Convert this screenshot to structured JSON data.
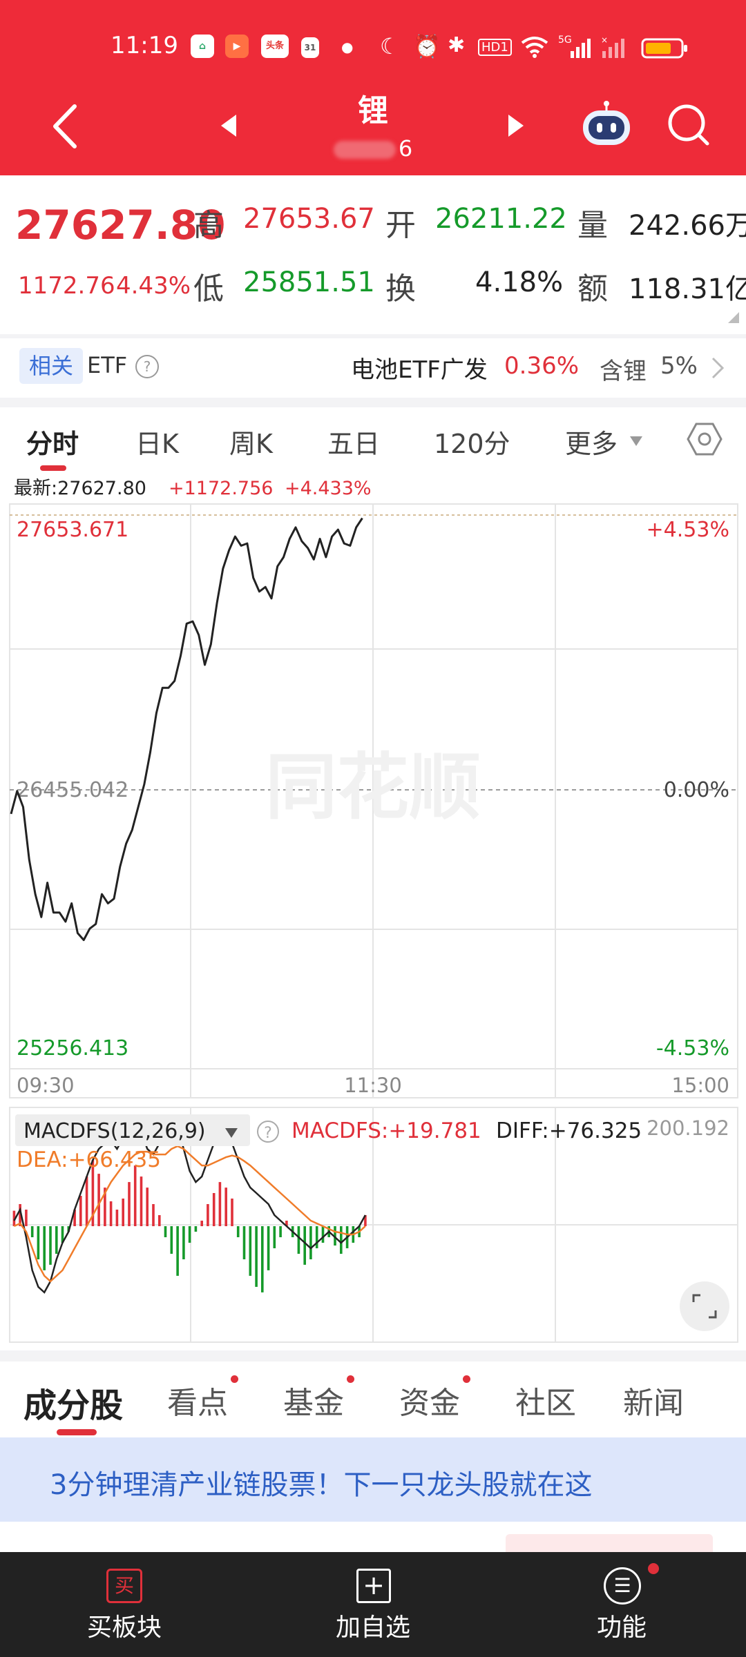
{
  "status_bar": {
    "time": "11:19",
    "icons": [
      "app-notification-icon",
      "video-app-icon",
      "toutiao-icon",
      "calendar-icon",
      "dot-icon",
      "moon-icon",
      "alarm-icon",
      "bluetooth-icon",
      "hd-icon",
      "wifi-icon",
      "signal-5g-icon",
      "signal-icon",
      "battery-icon"
    ],
    "toutiao_label": "头条",
    "hd_label": "HD1",
    "net_label": "5G"
  },
  "header": {
    "title": "锂",
    "code_suffix": "6"
  },
  "quote": {
    "price": "27627.80",
    "change": "1172.76",
    "change_pct": "4.43%",
    "high_label": "高",
    "high": "27653.67",
    "low_label": "低",
    "low": "25851.51",
    "open_label": "开",
    "open": "26211.22",
    "turnover_label": "换",
    "turnover": "4.18%",
    "volume_label": "量",
    "volume": "242.66万",
    "amount_label": "额",
    "amount": "118.31亿"
  },
  "etf": {
    "tag": "相关",
    "label": "ETF",
    "help": "?",
    "name": "电池ETF广发",
    "pct": "0.36%",
    "contain_label": "含锂",
    "contain_pct": "5%",
    "colors": {
      "tag_bg": "#e7eefc",
      "tag_text": "#3b6fd6"
    }
  },
  "period_tabs": {
    "items": [
      {
        "label": "分时",
        "active": true
      },
      {
        "label": "日K",
        "active": false
      },
      {
        "label": "周K",
        "active": false
      },
      {
        "label": "五日",
        "active": false
      },
      {
        "label": "120分",
        "active": false
      },
      {
        "label": "更多",
        "active": false
      }
    ]
  },
  "chart_header": {
    "latest_label": "最新:27627.80",
    "change": "+1172.756",
    "change_pct": "+4.433%"
  },
  "watermark": "同花顺",
  "chart_data": [
    {
      "type": "line",
      "name": "intraday",
      "y_top": "27653.671",
      "y_mid": "26455.042",
      "y_bottom": "25256.413",
      "pct_top": "+4.53%",
      "pct_mid": "0.00%",
      "pct_bottom": "-4.53%",
      "x_labels": [
        "09:30",
        "11:30",
        "15:00"
      ],
      "xlim": [
        0,
        240
      ],
      "ylim": [
        25256.413,
        27653.671
      ],
      "baseline": 26455.042,
      "x": [
        0,
        2,
        4,
        6,
        8,
        10,
        12,
        14,
        16,
        18,
        20,
        22,
        24,
        26,
        28,
        30,
        32,
        34,
        36,
        38,
        40,
        42,
        44,
        46,
        48,
        50,
        52,
        54,
        56,
        58,
        60,
        62,
        64,
        66,
        68,
        70,
        72,
        74,
        76,
        78,
        80,
        82,
        84,
        86,
        88,
        90,
        92,
        94,
        96,
        98,
        100,
        102,
        104,
        106,
        108,
        110,
        112,
        114,
        116
      ],
      "y": [
        26350,
        26450,
        26380,
        26150,
        26000,
        25900,
        26050,
        25920,
        25920,
        25880,
        25960,
        25830,
        25800,
        25850,
        25870,
        26000,
        25960,
        25980,
        26120,
        26220,
        26280,
        26380,
        26480,
        26620,
        26790,
        26900,
        26900,
        26930,
        27040,
        27180,
        27190,
        27130,
        27000,
        27090,
        27270,
        27420,
        27500,
        27560,
        27520,
        27530,
        27380,
        27320,
        27340,
        27290,
        27430,
        27470,
        27550,
        27600,
        27540,
        27510,
        27460,
        27550,
        27470,
        27560,
        27590,
        27530,
        27520,
        27600,
        27640
      ]
    },
    {
      "type": "bar",
      "name": "MACD",
      "title": "MACDFS(12,26,9)",
      "values_text": {
        "macd": "MACDFS:+19.781",
        "diff": "DIFF:+76.325",
        "dea": "DEA:+66.435"
      },
      "ytop_label": "200.192",
      "xlim": [
        0,
        240
      ],
      "ylim": [
        -200.192,
        200.192
      ],
      "bar_x": [
        1,
        3,
        5,
        7,
        9,
        11,
        13,
        15,
        17,
        19,
        21,
        23,
        25,
        27,
        29,
        31,
        33,
        35,
        37,
        39,
        41,
        43,
        45,
        47,
        49,
        51,
        53,
        55,
        57,
        59,
        61,
        63,
        65,
        67,
        69,
        71,
        73,
        75,
        77,
        79,
        81,
        83,
        85,
        87,
        89,
        91,
        93,
        95,
        97,
        99,
        101,
        103,
        105,
        107,
        109,
        111,
        113,
        115,
        117
      ],
      "bar_values": [
        28,
        40,
        30,
        -20,
        -60,
        -80,
        -70,
        -50,
        -30,
        -10,
        30,
        55,
        90,
        120,
        95,
        70,
        45,
        30,
        50,
        80,
        110,
        90,
        70,
        40,
        20,
        -20,
        -50,
        -90,
        -60,
        -30,
        -10,
        10,
        40,
        60,
        80,
        70,
        50,
        -20,
        -60,
        -90,
        -110,
        -120,
        -80,
        -40,
        -20,
        10,
        -20,
        -50,
        -70,
        -60,
        -40,
        -30,
        -20,
        -35,
        -50,
        -40,
        -30,
        -20,
        20
      ],
      "diff_y": [
        10,
        30,
        -20,
        -80,
        -110,
        -120,
        -100,
        -60,
        -30,
        -10,
        30,
        60,
        90,
        120,
        140,
        150,
        155,
        140,
        160,
        180,
        190,
        170,
        140,
        130,
        150,
        170,
        190,
        180,
        140,
        100,
        80,
        90,
        120,
        150,
        180,
        170,
        150,
        120,
        90,
        70,
        60,
        50,
        40,
        20,
        10,
        0,
        -10,
        -20,
        -30,
        -40,
        -30,
        -20,
        -10,
        -20,
        -30,
        -20,
        -10,
        0,
        20
      ],
      "dea_y": [
        0,
        5,
        -10,
        -40,
        -70,
        -90,
        -100,
        -90,
        -80,
        -60,
        -40,
        -20,
        0,
        20,
        40,
        60,
        80,
        95,
        110,
        120,
        130,
        135,
        135,
        130,
        130,
        130,
        140,
        145,
        140,
        130,
        120,
        110,
        110,
        115,
        120,
        125,
        128,
        125,
        118,
        110,
        100,
        90,
        80,
        70,
        60,
        50,
        40,
        30,
        20,
        10,
        5,
        0,
        -5,
        -10,
        -12,
        -15,
        -15,
        -10,
        0
      ]
    }
  ],
  "sub_tabs": {
    "items": [
      {
        "label": "成分股",
        "active": true,
        "dot": false
      },
      {
        "label": "看点",
        "active": false,
        "dot": true
      },
      {
        "label": "基金",
        "active": false,
        "dot": true
      },
      {
        "label": "资金",
        "active": false,
        "dot": true
      },
      {
        "label": "社区",
        "active": false,
        "dot": false
      },
      {
        "label": "新闻",
        "active": false,
        "dot": false
      }
    ]
  },
  "banner": {
    "text": "3分钟理清产业链股票！下一只龙头股就在这"
  },
  "bottom_nav": {
    "items": [
      {
        "label": "买板块",
        "icon": "buy-icon",
        "glyph": "买"
      },
      {
        "label": "加自选",
        "icon": "add-watchlist-icon",
        "glyph": "+"
      },
      {
        "label": "功能",
        "icon": "menu-icon",
        "glyph": "☰"
      }
    ]
  },
  "colors": {
    "brand": "#ee2b39",
    "up": "#e0303a",
    "down": "#159a2a",
    "dea": "#f07c2a"
  }
}
